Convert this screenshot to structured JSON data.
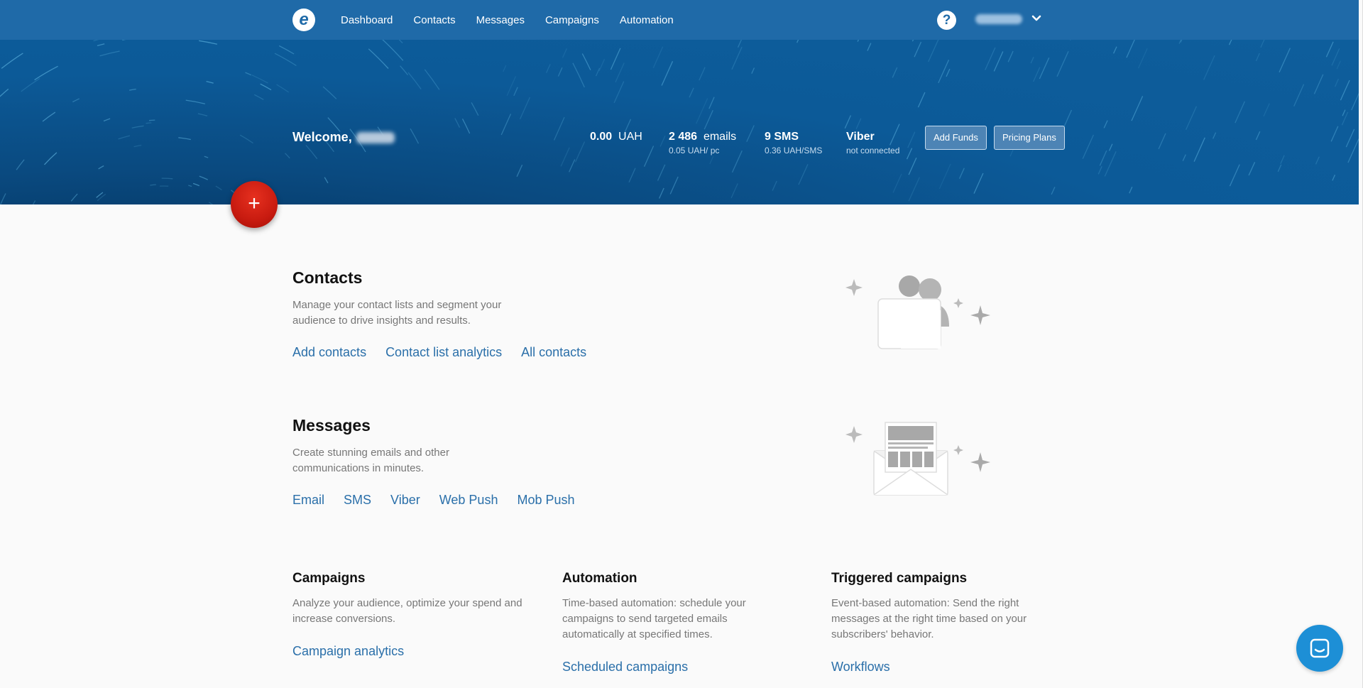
{
  "nav": {
    "items": [
      "Dashboard",
      "Contacts",
      "Messages",
      "Campaigns",
      "Automation"
    ]
  },
  "header": {
    "help_symbol": "?"
  },
  "hero": {
    "welcome_label": "Welcome,",
    "balance": {
      "value": "0.00",
      "unit": "UAH"
    },
    "emails": {
      "value": "2 486",
      "unit": "emails",
      "rate": "0.05 UAH/ pc"
    },
    "sms": {
      "value": "9 SMS",
      "rate": "0.36  UAH/SMS"
    },
    "viber": {
      "title": "Viber",
      "status": "not connected"
    },
    "add_funds_label": "Add Funds",
    "pricing_plans_label": "Pricing Plans"
  },
  "fab": {
    "symbol": "+"
  },
  "contacts": {
    "title": "Contacts",
    "desc_line1": "Manage your contact lists and segment your",
    "desc_line2": "audience to drive insights and results.",
    "links": [
      "Add contacts",
      "Contact list analytics",
      "All contacts"
    ]
  },
  "messages": {
    "title": "Messages",
    "desc_line1": "Create stunning emails and other",
    "desc_line2": "communications in minutes.",
    "links": [
      "Email",
      "SMS",
      "Viber",
      "Web Push",
      "Mob Push"
    ]
  },
  "campaigns": {
    "title": "Campaigns",
    "desc_line1": "Analyze your audience, optimize your spend and",
    "desc_line2": "increase conversions.",
    "link": "Campaign analytics"
  },
  "automation": {
    "title": "Automation",
    "desc_line1": "Time-based automation: schedule your",
    "desc_line2": "campaigns to send targeted emails",
    "desc_line3": "automatically at specified times.",
    "link": "Scheduled campaigns"
  },
  "triggered": {
    "title": "Triggered campaigns",
    "desc_line1": "Event-based automation: Send the right",
    "desc_line2": "messages at the right time based on your",
    "desc_line3": "subscribers' behavior.",
    "link": "Workflows"
  },
  "colors": {
    "topbar": "#1f6aa8",
    "link": "#2a6fa9",
    "fab": "#c81b10",
    "chat": "#1d8fd6"
  }
}
